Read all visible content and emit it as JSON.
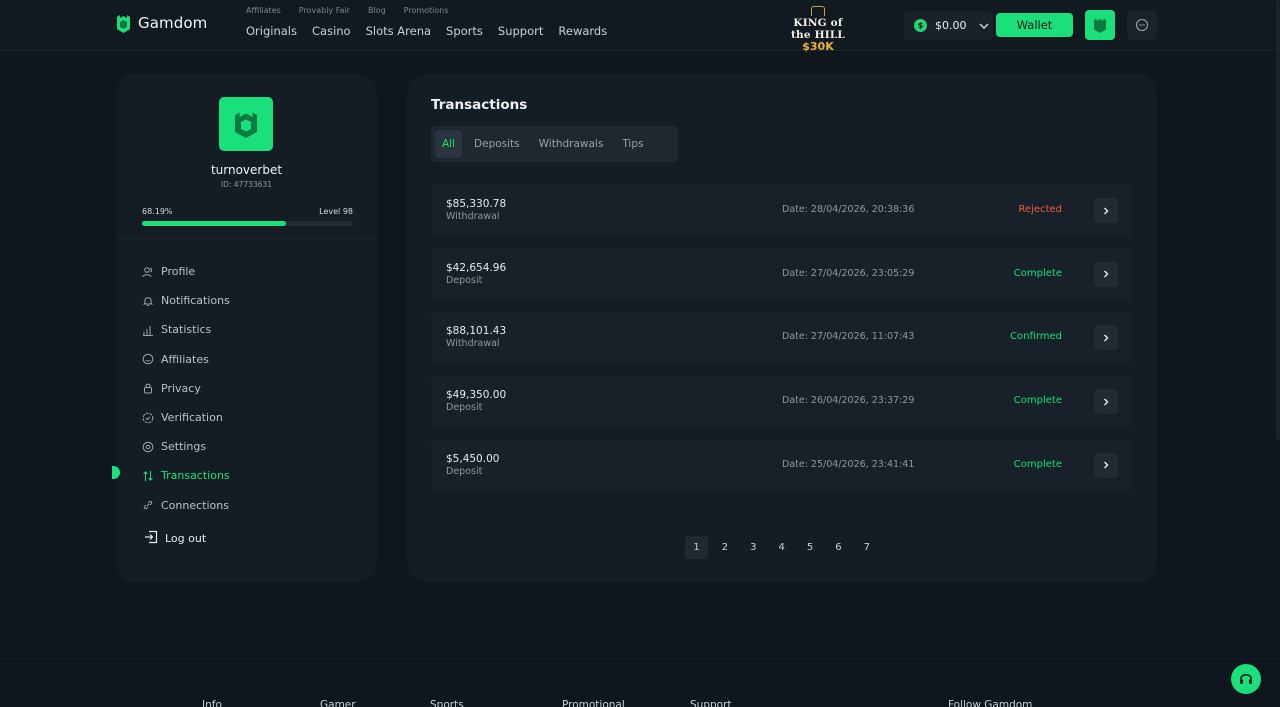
{
  "header": {
    "brand": "Gamdom",
    "subnav": [
      "Affiliates",
      "Provably Fair",
      "Blog",
      "Promotions"
    ],
    "mainnav": [
      "Originals",
      "Casino",
      "Slots Arena",
      "Sports",
      "Support",
      "Rewards"
    ],
    "promo": {
      "line1": "KING of the HILL",
      "line2": "$30K"
    },
    "balance": "$0.00",
    "currency_symbol": "$",
    "wallet_label": "Wallet"
  },
  "profile": {
    "username": "turnoverbet",
    "user_id": "ID: 47733631",
    "progress_text": "68.19%",
    "progress": 68.19,
    "level": "Level 98"
  },
  "menu": [
    {
      "label": "Profile",
      "icon": "user-icon"
    },
    {
      "label": "Notifications",
      "icon": "bell-icon"
    },
    {
      "label": "Statistics",
      "icon": "bar-chart-icon"
    },
    {
      "label": "Affiliates",
      "icon": "smile-icon"
    },
    {
      "label": "Privacy",
      "icon": "lock-icon"
    },
    {
      "label": "Verification",
      "icon": "verify-icon"
    },
    {
      "label": "Settings",
      "icon": "gear-icon"
    },
    {
      "label": "Transactions",
      "icon": "transfer-icon",
      "active": true
    },
    {
      "label": "Connections",
      "icon": "link-icon"
    }
  ],
  "logout_label": "Log out",
  "transactions": {
    "title": "Transactions",
    "tabs": [
      "All",
      "Deposits",
      "Withdrawals",
      "Tips"
    ],
    "active_tab": "All",
    "rows": [
      {
        "amount": "$85,330.78",
        "type": "Withdrawal",
        "date": "Date: 28/04/2026, 20:38:36",
        "status": "Rejected",
        "status_color": "#ef5b4c"
      },
      {
        "amount": "$42,654.96",
        "type": "Deposit",
        "date": "Date: 27/04/2026, 23:05:29",
        "status": "Complete",
        "status_color": "#19e07b"
      },
      {
        "amount": "$88,101.43",
        "type": "Withdrawal",
        "date": "Date: 27/04/2026, 11:07:43",
        "status": "Confirmed",
        "status_color": "#19e07b"
      },
      {
        "amount": "$49,350.00",
        "type": "Deposit",
        "date": "Date: 26/04/2026, 23:37:29",
        "status": "Complete",
        "status_color": "#19e07b"
      },
      {
        "amount": "$5,450.00",
        "type": "Deposit",
        "date": "Date: 25/04/2026, 23:41:41",
        "status": "Complete",
        "status_color": "#19e07b"
      }
    ],
    "pages": [
      "1",
      "2",
      "3",
      "4",
      "5",
      "6",
      "7"
    ],
    "current_page": "1"
  },
  "footer": {
    "columns": [
      "Info",
      "Gamer",
      "Sports",
      "Promotional",
      "Support",
      "Follow Gamdom"
    ]
  },
  "colors": {
    "accent": "#19e07b",
    "bg": "#0f161d",
    "panel": "#151d24"
  }
}
